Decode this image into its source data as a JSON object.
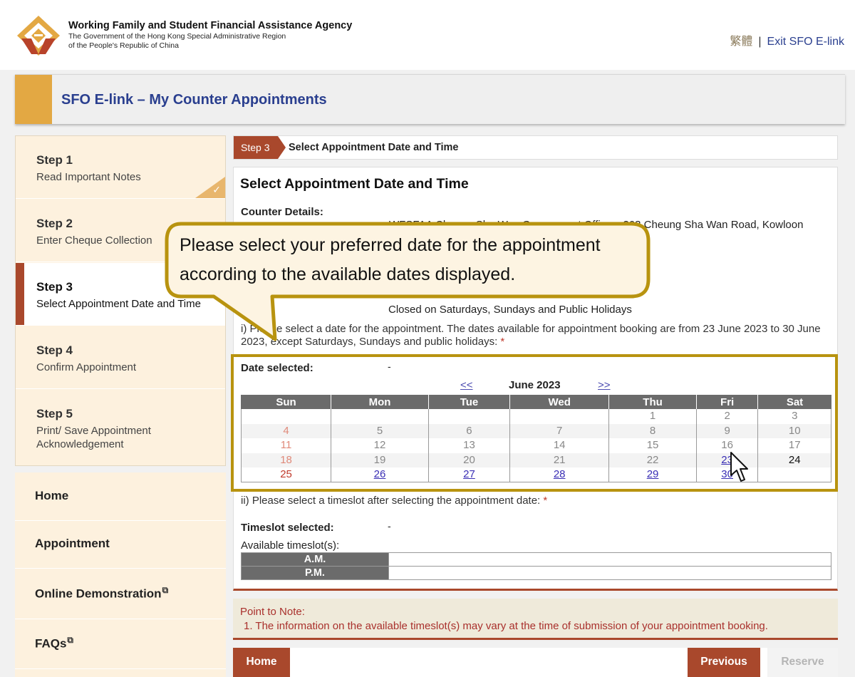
{
  "header": {
    "agency_name": "Working Family and Student Financial Assistance Agency",
    "agency_sub1": "The Government of the Hong Kong Special Administrative Region",
    "agency_sub2": "of the People's Republic of China",
    "lang_link": "繁體",
    "separator": "|",
    "exit_link": "Exit SFO E-link"
  },
  "page_title": "SFO E-link – My Counter Appointments",
  "steps": [
    {
      "num": "Step 1",
      "desc": "Read Important Notes",
      "done": true
    },
    {
      "num": "Step 2",
      "desc": "Enter Cheque Collection"
    },
    {
      "num": "Step 3",
      "desc": "Select Appointment Date and Time",
      "active": true
    },
    {
      "num": "Step 4",
      "desc": "Confirm Appointment"
    },
    {
      "num": "Step 5",
      "desc": "Print/ Save Appointment Acknowledgement"
    }
  ],
  "check_mark": "✓",
  "nav": [
    {
      "label": "Home"
    },
    {
      "label": "Appointment"
    },
    {
      "label": "Online Demonstration",
      "external": true
    },
    {
      "label": "FAQs",
      "external": true
    }
  ],
  "external_icon": "⧉",
  "stepbar": {
    "tag": "Step 3",
    "text": "Select Appointment Date and Time"
  },
  "panel": {
    "title": "Select Appointment Date and Time",
    "counter_label": "Counter Details:",
    "address": "WFSFAA Cheung Sha Wan Government Offices, 303 Cheung Sha Wan Road, Kowloon",
    "hours": "Closed on Saturdays, Sundays and Public Holidays",
    "instruction1": "i) Please select a date for the appointment. The dates available for appointment booking are from 23 June 2023 to 30 June 2023, except Saturdays, Sundays and public holidays: ",
    "required_mark": "*",
    "date_selected_label": "Date selected:",
    "date_selected_value": "-",
    "instruction2": "ii) Please select a timeslot after selecting the appointment date: ",
    "timeslot_selected_label": "Timeslot selected:",
    "timeslot_selected_value": "-",
    "available_label": "Available timeslot(s):",
    "timeslots": [
      "A.M.",
      "P.M."
    ]
  },
  "calendar": {
    "prev": "<<",
    "next": ">>",
    "month": "June 2023",
    "days": [
      "Sun",
      "Mon",
      "Tue",
      "Wed",
      "Thu",
      "Fri",
      "Sat"
    ],
    "weeks": [
      [
        {
          "d": ""
        },
        {
          "d": ""
        },
        {
          "d": ""
        },
        {
          "d": ""
        },
        {
          "d": "1"
        },
        {
          "d": "2"
        },
        {
          "d": "3"
        }
      ],
      [
        {
          "d": "4",
          "c": "sun"
        },
        {
          "d": "5"
        },
        {
          "d": "6"
        },
        {
          "d": "7"
        },
        {
          "d": "8"
        },
        {
          "d": "9"
        },
        {
          "d": "10"
        }
      ],
      [
        {
          "d": "11",
          "c": "sun"
        },
        {
          "d": "12"
        },
        {
          "d": "13"
        },
        {
          "d": "14"
        },
        {
          "d": "15"
        },
        {
          "d": "16"
        },
        {
          "d": "17"
        }
      ],
      [
        {
          "d": "18",
          "c": "sun"
        },
        {
          "d": "19"
        },
        {
          "d": "20"
        },
        {
          "d": "21"
        },
        {
          "d": "22"
        },
        {
          "d": "23",
          "link": true
        },
        {
          "d": "24",
          "c": "sat-cur"
        }
      ],
      [
        {
          "d": "25",
          "c": "sun-cur"
        },
        {
          "d": "26",
          "link": true
        },
        {
          "d": "27",
          "link": true
        },
        {
          "d": "28",
          "link": true
        },
        {
          "d": "29",
          "link": true
        },
        {
          "d": "30",
          "link": true
        },
        {
          "d": ""
        }
      ]
    ]
  },
  "note": {
    "title": "Point to Note:",
    "text": "1. The information on the available timeslot(s) may vary at the time of submission of your appointment booking."
  },
  "buttons": {
    "home": "Home",
    "previous": "Previous",
    "reserve": "Reserve"
  },
  "tooltip": {
    "text": "Please select your preferred date for the appointment according to the available dates displayed."
  },
  "colors": {
    "brand_red": "#a9482c",
    "brand_gold": "#e3a843",
    "title_blue": "#2a3f8f",
    "highlight": "#b8930f"
  }
}
